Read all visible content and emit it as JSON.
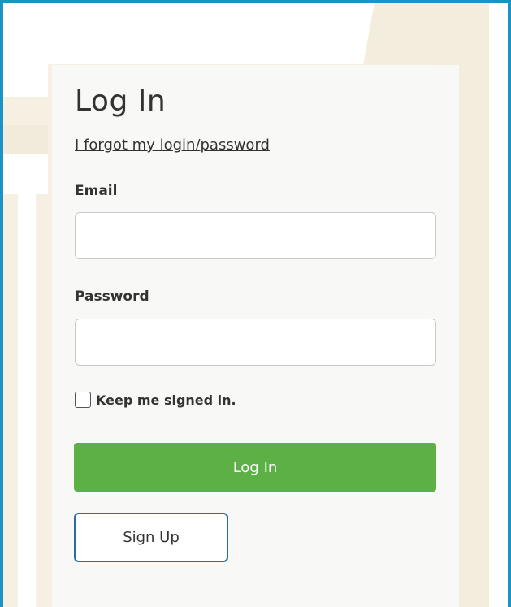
{
  "login": {
    "title": "Log In",
    "forgot_link": "I forgot my login/password",
    "email_label": "Email",
    "email_value": "",
    "email_placeholder": "",
    "password_label": "Password",
    "password_value": "",
    "password_placeholder": "",
    "remember_label": "Keep me signed in.",
    "remember_checked": false,
    "login_button": "Log In",
    "signup_button": "Sign Up"
  },
  "colors": {
    "frame_border": "#1e93c3",
    "login_button_bg": "#5db046",
    "signup_button_border": "#2b6aa3",
    "panel_bg": "#f8f8f6"
  }
}
